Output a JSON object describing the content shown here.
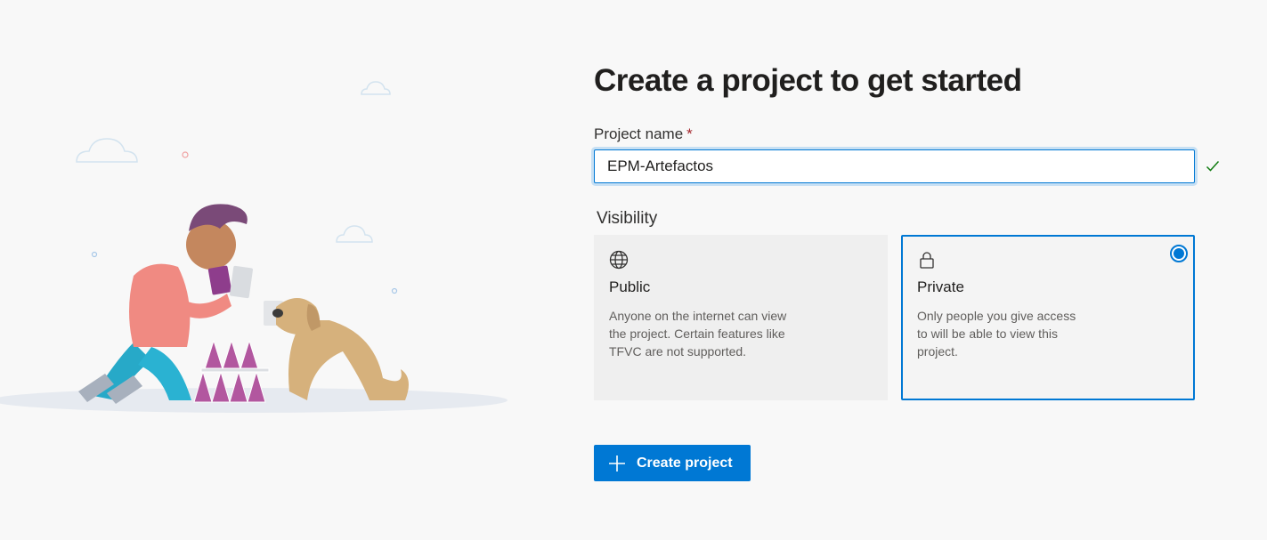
{
  "page": {
    "title": "Create a project to get started"
  },
  "project_name": {
    "label": "Project name",
    "required_marker": "*",
    "value": "EPM-Artefactos",
    "valid_icon": "checkmark-icon"
  },
  "visibility": {
    "label": "Visibility",
    "options": [
      {
        "title": "Public",
        "icon": "globe-icon",
        "description": "Anyone on the internet can view the project. Certain features like TFVC are not supported.",
        "selected": false
      },
      {
        "title": "Private",
        "icon": "lock-icon",
        "description": "Only people you give access to will be able to view this project.",
        "selected": true
      }
    ]
  },
  "actions": {
    "create_label": "Create project",
    "create_icon": "plus-icon"
  },
  "colors": {
    "accent": "#0078d4",
    "background": "#f8f8f8",
    "required": "#a4262c",
    "valid": "#107c10"
  }
}
